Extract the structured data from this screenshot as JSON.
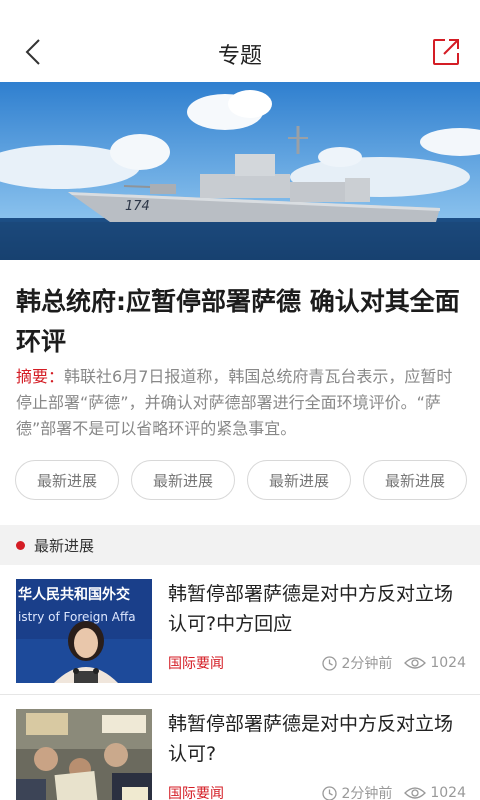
{
  "header": {
    "title": "专题"
  },
  "article": {
    "headline": "韩总统府:应暂停部署萨德 确认对其全面环评",
    "summary_tag": "摘要：",
    "summary_text": "韩联社6月7日报道称，韩国总统府青瓦台表示，应暂时停止部署“萨德”，并确认对萨德部署进行全面环境评价。“萨德”部署不是可以省略环评的紧急事宜。"
  },
  "chips": [
    "最新进展",
    "最新进展",
    "最新进展",
    "最新进展"
  ],
  "section": {
    "label": "最新进展"
  },
  "news": [
    {
      "title": "韩暂停部署萨德是对中方反对立场认可?中方回应",
      "category": "国际要闻",
      "time": "2分钟前",
      "views": "1024"
    },
    {
      "title": "韩暂停部署萨德是对中方反对立场认可?",
      "category": "国际要闻",
      "time": "2分钟前",
      "views": "1024"
    }
  ],
  "hero_ship_number": "174",
  "thumb1_text": [
    "华人民共和国外交",
    "istry of Foreign Affa"
  ],
  "colors": {
    "accent": "#d41d25"
  },
  "icons": {
    "back": "back-arrow-icon",
    "share": "share-edit-icon",
    "clock": "clock-icon",
    "eye": "eye-icon"
  }
}
